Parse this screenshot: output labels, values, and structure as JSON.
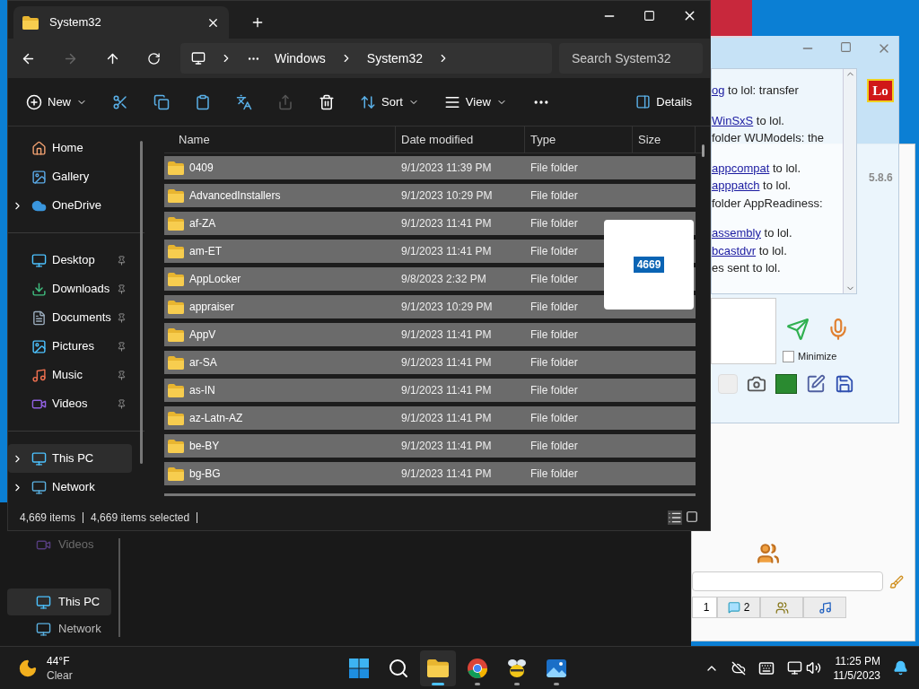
{
  "explorer": {
    "tab_title": "System32",
    "forward": {
      "disabled": true
    },
    "breadcrumb": [
      "Windows",
      "System32"
    ],
    "search": {
      "placeholder": "Search System32"
    },
    "toolbar": {
      "new": "New",
      "share": {
        "disabled": true
      },
      "sort": "Sort",
      "view": "View",
      "details": "Details"
    },
    "sidebar": [
      [
        {
          "kind": "home",
          "label": "Home",
          "expandable": false,
          "pinned": false,
          "selected": false
        },
        {
          "kind": "gallery",
          "label": "Gallery",
          "expandable": false,
          "pinned": false,
          "selected": false
        },
        {
          "kind": "onedrive",
          "label": "OneDrive",
          "expandable": true,
          "pinned": false,
          "selected": false
        }
      ],
      [
        {
          "kind": "desktop",
          "label": "Desktop",
          "expandable": false,
          "pinned": true,
          "selected": false
        },
        {
          "kind": "downloads",
          "label": "Downloads",
          "expandable": false,
          "pinned": true,
          "selected": false
        },
        {
          "kind": "documents",
          "label": "Documents",
          "expandable": false,
          "pinned": true,
          "selected": false
        },
        {
          "kind": "pictures",
          "label": "Pictures",
          "expandable": false,
          "pinned": true,
          "selected": false
        },
        {
          "kind": "music",
          "label": "Music",
          "expandable": false,
          "pinned": true,
          "selected": false
        },
        {
          "kind": "videos",
          "label": "Videos",
          "expandable": false,
          "pinned": true,
          "selected": false
        }
      ],
      [
        {
          "kind": "thispc",
          "label": "This PC",
          "expandable": true,
          "pinned": false,
          "selected": true
        },
        {
          "kind": "network",
          "label": "Network",
          "expandable": true,
          "pinned": false,
          "selected": false
        }
      ]
    ],
    "columns": [
      "Name",
      "Date modified",
      "Type",
      "Size"
    ],
    "rows": [
      {
        "name": "0409",
        "date": "9/1/2023 11:39 PM",
        "type": "File folder",
        "selected": true
      },
      {
        "name": "AdvancedInstallers",
        "date": "9/1/2023 10:29 PM",
        "type": "File folder",
        "selected": true
      },
      {
        "name": "af-ZA",
        "date": "9/1/2023 11:41 PM",
        "type": "File folder",
        "selected": true
      },
      {
        "name": "am-ET",
        "date": "9/1/2023 11:41 PM",
        "type": "File folder",
        "selected": true
      },
      {
        "name": "AppLocker",
        "date": "9/8/2023 2:32 PM",
        "type": "File folder",
        "selected": true
      },
      {
        "name": "appraiser",
        "date": "9/1/2023 10:29 PM",
        "type": "File folder",
        "selected": true
      },
      {
        "name": "AppV",
        "date": "9/1/2023 11:41 PM",
        "type": "File folder",
        "selected": true
      },
      {
        "name": "ar-SA",
        "date": "9/1/2023 11:41 PM",
        "type": "File folder",
        "selected": true
      },
      {
        "name": "as-IN",
        "date": "9/1/2023 11:41 PM",
        "type": "File folder",
        "selected": true
      },
      {
        "name": "az-Latn-AZ",
        "date": "9/1/2023 11:41 PM",
        "type": "File folder",
        "selected": true
      },
      {
        "name": "be-BY",
        "date": "9/1/2023 11:41 PM",
        "type": "File folder",
        "selected": true
      },
      {
        "name": "bg-BG",
        "date": "9/1/2023 11:41 PM",
        "type": "File folder",
        "selected": true
      }
    ],
    "drag_count": "4669",
    "status": [
      "4,669 items",
      "4,669 items selected"
    ]
  },
  "background_explorer": {
    "sidebar": [
      {
        "kind": "videos",
        "label": "Videos",
        "selected": false
      },
      {
        "kind": "thispc",
        "label": "This PC",
        "selected": true
      },
      {
        "kind": "network",
        "label": "Network",
        "selected": false
      }
    ]
  },
  "chat_window": {
    "logo": "Lo",
    "messages": [
      [
        {
          "link": "og",
          "text": " to lol: transfer"
        }
      ],
      [
        {
          "link": "WinSxS",
          "text": " to lol."
        },
        {
          "text": "folder WUModels: the"
        }
      ],
      [
        {
          "link": "appcompat",
          "text": " to lol."
        },
        {
          "link": "apppatch",
          "text": " to lol."
        },
        {
          "text": "folder AppReadiness:"
        }
      ],
      [
        {
          "link": "assembly",
          "text": " to lol."
        },
        {
          "link": "bcastdvr",
          "text": " to lol."
        },
        {
          "text": "es sent to lol."
        }
      ]
    ],
    "minimize": {
      "label": "Minimize",
      "checked": false
    }
  },
  "back_window": {
    "version": "5.8.6",
    "tabs": [
      {
        "kind": "contacts",
        "label": "1",
        "selected": true
      },
      {
        "kind": "chat",
        "label": "2",
        "selected": false
      },
      {
        "kind": "group",
        "selected": false
      },
      {
        "kind": "music",
        "selected": false
      }
    ]
  },
  "taskbar": {
    "weather": {
      "temp": "44°F",
      "condition": "Clear"
    },
    "apps": [
      {
        "kind": "start",
        "active": false,
        "running": false
      },
      {
        "kind": "search",
        "active": false,
        "running": false
      },
      {
        "kind": "explorer",
        "active": true,
        "running": true
      },
      {
        "kind": "browser",
        "active": false,
        "running": true
      },
      {
        "kind": "bee",
        "active": false,
        "running": true
      },
      {
        "kind": "photos",
        "active": false,
        "running": true
      }
    ],
    "time": "11:25 PM",
    "date": "11/5/2023"
  }
}
